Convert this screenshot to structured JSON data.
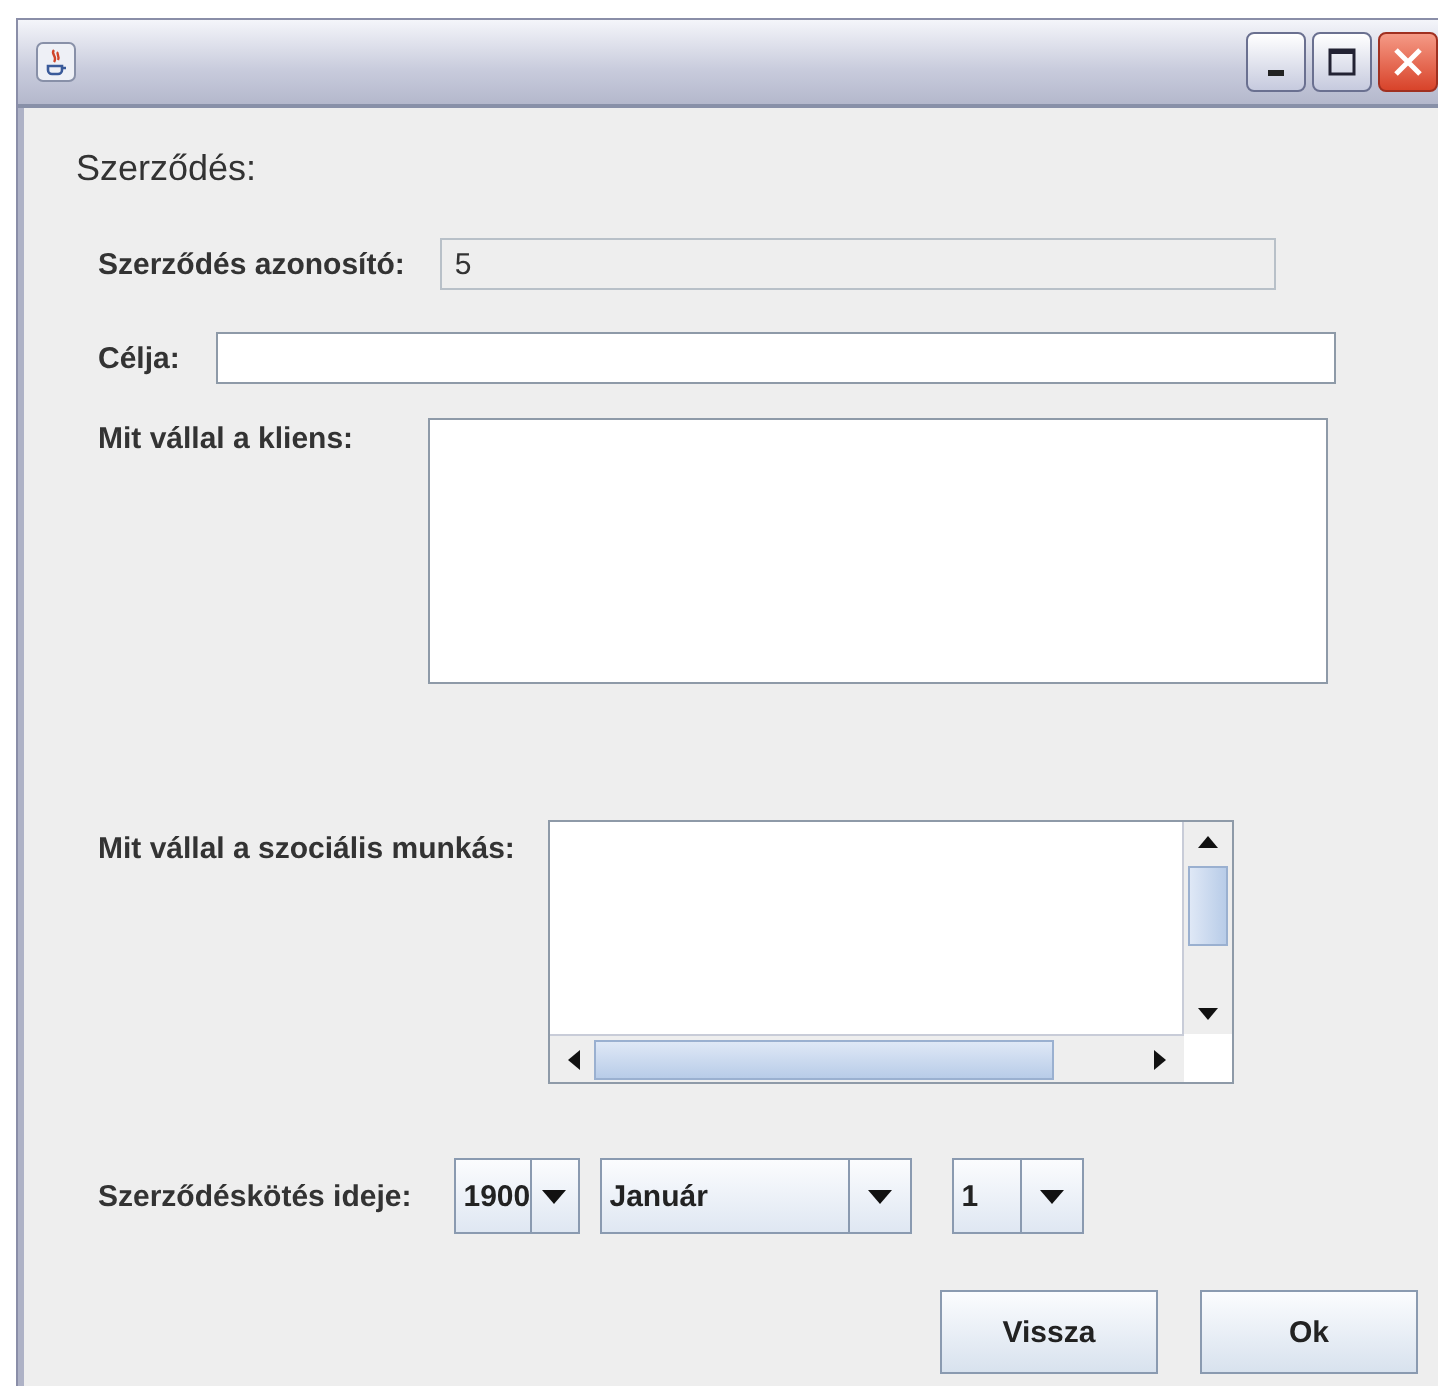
{
  "heading": "Szerződés:",
  "id_field": {
    "label": "Szerződés azonosító:",
    "value": "5",
    "disabled": true
  },
  "goal_field": {
    "label": "Célja:"
  },
  "client_area": {
    "label": "Mit vállal a kliens:"
  },
  "worker_area": {
    "label": "Mit vállal a szociális munkás:"
  },
  "date": {
    "label": "Szerződéskötés ideje:",
    "year": "1900",
    "month": "Január",
    "day": "1"
  },
  "buttons": [
    "Vissza",
    "Ok"
  ]
}
